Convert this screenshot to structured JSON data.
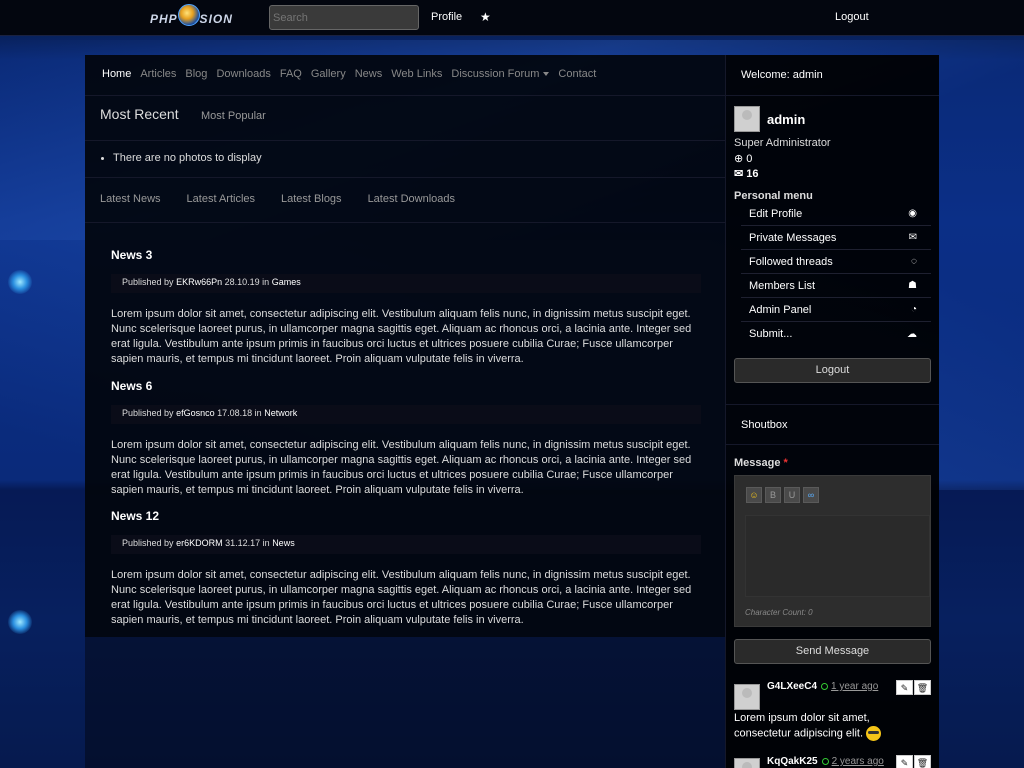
{
  "topbar": {
    "logo_text": "PHP FUSION",
    "search_placeholder": "Search",
    "profile_label": "Profile",
    "star_icon": "★",
    "logout_label": "Logout"
  },
  "nav": {
    "items": [
      "Home",
      "Articles",
      "Blog",
      "Downloads",
      "FAQ",
      "Gallery",
      "News",
      "Web Links",
      "Discussion Forum",
      "Contact"
    ]
  },
  "photos": {
    "tab_recent": "Most Recent",
    "tab_popular": "Most Popular",
    "empty_text": "There are no photos to display"
  },
  "content_tabs": [
    "Latest News",
    "Latest Articles",
    "Latest Blogs",
    "Latest Downloads"
  ],
  "news": [
    {
      "title": "News 3",
      "published_by": "Published by",
      "author": "EKRw66Pn",
      "date": "28.10.19",
      "in": "in",
      "category": "Games",
      "body": "Lorem ipsum dolor sit amet, consectetur adipiscing elit. Vestibulum aliquam felis nunc, in dignissim metus suscipit eget. Nunc scelerisque laoreet purus, in ullamcorper magna sagittis eget. Aliquam ac rhoncus orci, a lacinia ante. Integer sed erat ligula. Vestibulum ante ipsum primis in faucibus orci luctus et ultrices posuere cubilia Curae; Fusce ullamcorper sapien mauris, et tempus mi tincidunt laoreet. Proin aliquam vulputate felis in viverra."
    },
    {
      "title": "News 6",
      "published_by": "Published by",
      "author": "efGosnco",
      "date": "17.08.18",
      "in": "in",
      "category": "Network",
      "body": "Lorem ipsum dolor sit amet, consectetur adipiscing elit. Vestibulum aliquam felis nunc, in dignissim metus suscipit eget. Nunc scelerisque laoreet purus, in ullamcorper magna sagittis eget. Aliquam ac rhoncus orci, a lacinia ante. Integer sed erat ligula. Vestibulum ante ipsum primis in faucibus orci luctus et ultrices posuere cubilia Curae; Fusce ullamcorper sapien mauris, et tempus mi tincidunt laoreet. Proin aliquam vulputate felis in viverra."
    },
    {
      "title": "News 12",
      "published_by": "Published by",
      "author": "er6KDORM",
      "date": "31.12.17",
      "in": "in",
      "category": "News",
      "body": "Lorem ipsum dolor sit amet, consectetur adipiscing elit. Vestibulum aliquam felis nunc, in dignissim metus suscipit eget. Nunc scelerisque laoreet purus, in ullamcorper magna sagittis eget. Aliquam ac rhoncus orci, a lacinia ante. Integer sed erat ligula. Vestibulum ante ipsum primis in faucibus orci luctus et ultrices posuere cubilia Curae; Fusce ullamcorper sapien mauris, et tempus mi tincidunt laoreet. Proin aliquam vulputate felis in viverra."
    }
  ],
  "sidebar": {
    "welcome": "Welcome: admin",
    "username": "admin",
    "role": "Super Administrator",
    "points": "0",
    "messages": "16",
    "personal_menu_title": "Personal menu",
    "menu": [
      {
        "label": "Edit Profile",
        "icon": "user-circle-icon"
      },
      {
        "label": "Private Messages",
        "icon": "envelope-icon"
      },
      {
        "label": "Followed threads",
        "icon": "comment-icon"
      },
      {
        "label": "Members List",
        "icon": "users-icon"
      },
      {
        "label": "Admin Panel",
        "icon": "dashboard-icon"
      },
      {
        "label": "Submit...",
        "icon": "cloud-upload-icon"
      }
    ],
    "logout_label": "Logout"
  },
  "shoutbox": {
    "title": "Shoutbox",
    "message_label": "Message",
    "required_mark": "*",
    "char_count": "Character Count: 0",
    "send_label": "Send Message",
    "shouts": [
      {
        "user": "G4LXeeC4",
        "time": "1 year ago",
        "text": "Lorem ipsum dolor sit amet, consectetur adipiscing elit."
      },
      {
        "user": "KqQakK25",
        "time": "2 years ago",
        "text": ""
      }
    ]
  },
  "colors": {
    "accent": "#0b2f87",
    "panel": "#02050c",
    "text": "#dddddd",
    "online": "#33cc33",
    "required": "#ee3333"
  }
}
